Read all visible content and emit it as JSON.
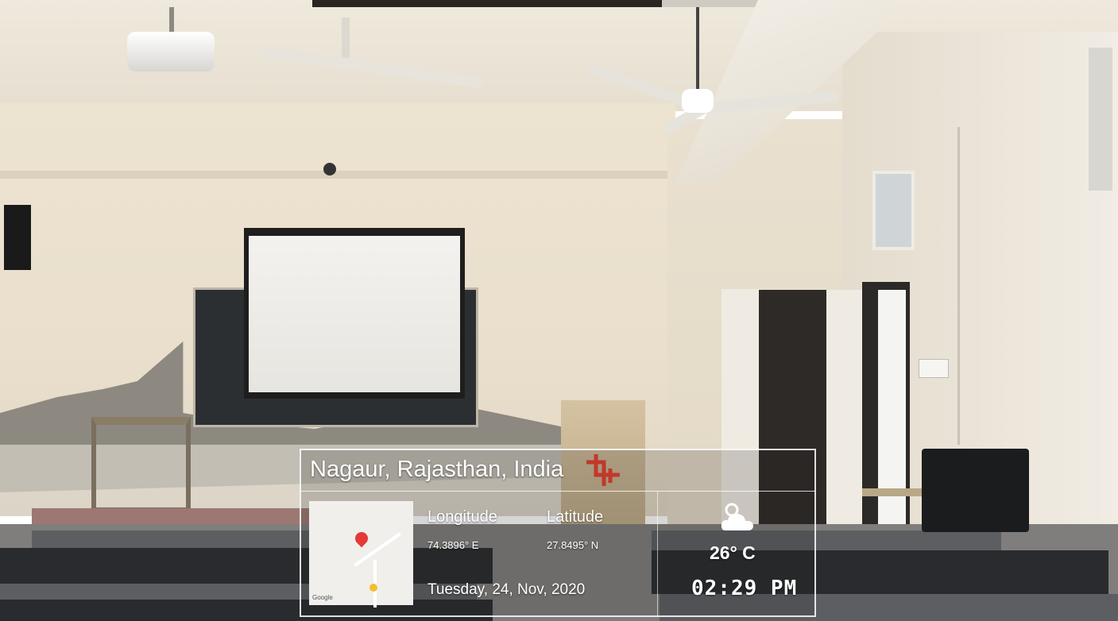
{
  "overlay": {
    "location": "Nagaur, Rajasthan, India",
    "longitude_label": "Longitude",
    "longitude_value": "74.3896° E",
    "latitude_label": "Latitude",
    "latitude_value": "27.8495° N",
    "date": "Tuesday, 24, Nov, 2020",
    "temperature": "26° C",
    "time": "02:29 PM",
    "map_brand": "Google",
    "weather_icon": "partly-cloudy-icon"
  },
  "colors": {
    "overlay_text": "#ffffff",
    "map_pin": "#e53935",
    "logo_mark": "#c0392b"
  }
}
